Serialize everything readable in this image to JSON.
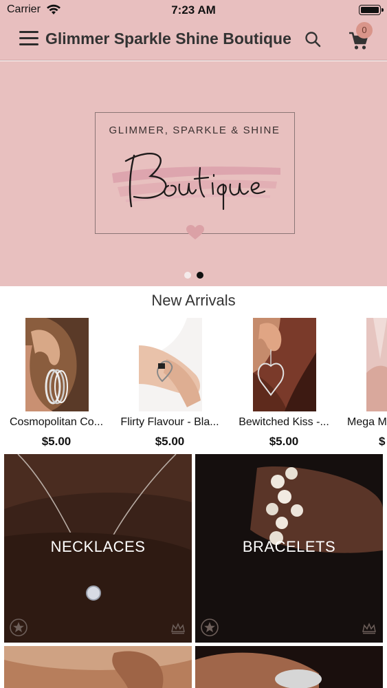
{
  "status_bar": {
    "carrier": "Carrier",
    "time": "7:23 AM",
    "icons": [
      "wifi-icon",
      "battery-icon"
    ]
  },
  "nav": {
    "title": "Glimmer Sparkle Shine Boutique",
    "cart_count": "0",
    "icons": [
      "menu-icon",
      "search-icon",
      "cart-icon"
    ],
    "background": "#e8bfbf"
  },
  "hero": {
    "logo_top": "GLIMMER, SPARKLE & SHINE",
    "logo_script": "Boutique",
    "slides_count": 2,
    "active_slide": 2,
    "background": "#e8c0bf"
  },
  "new_arrivals": {
    "title": "New Arrivals",
    "products": [
      {
        "name": "Cosmopolitan Co...",
        "price": "$5.00"
      },
      {
        "name": "Flirty Flavour - Bla...",
        "price": "$5.00"
      },
      {
        "name": "Bewitched Kiss -...",
        "price": "$5.00"
      },
      {
        "name": "Mega M",
        "price": "$"
      }
    ]
  },
  "categories": [
    {
      "label": "NECKLACES"
    },
    {
      "label": "BRACELETS"
    },
    {
      "label": ""
    },
    {
      "label": ""
    }
  ]
}
